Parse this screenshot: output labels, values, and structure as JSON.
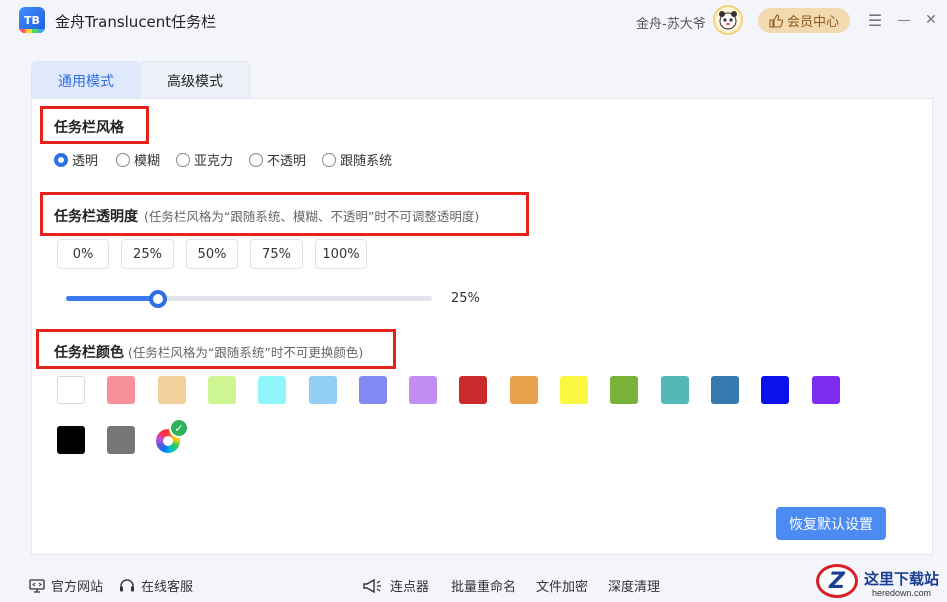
{
  "app": {
    "logo_text": "TB",
    "title": "金舟Translucent任务栏",
    "user_name": "金舟-苏大爷",
    "vip_label": "会员中心"
  },
  "window_controls": {
    "menu": "☰",
    "minimize": "—",
    "close": "✕"
  },
  "tabs": [
    {
      "label": "通用模式",
      "active": true
    },
    {
      "label": "高级模式",
      "active": false
    }
  ],
  "style_section": {
    "title": "任务栏风格",
    "options": [
      {
        "label": "透明",
        "checked": true
      },
      {
        "label": "模糊",
        "checked": false
      },
      {
        "label": "亚克力",
        "checked": false
      },
      {
        "label": "不透明",
        "checked": false
      },
      {
        "label": "跟随系统",
        "checked": false
      }
    ]
  },
  "opacity_section": {
    "title": "任务栏透明度",
    "note": "(任务栏风格为“跟随系统、模糊、不透明”时不可调整透明度)",
    "presets": [
      "0%",
      "25%",
      "50%",
      "75%",
      "100%"
    ],
    "slider_value": 25,
    "slider_label": "25%"
  },
  "color_section": {
    "title": "任务栏颜色",
    "note": "(任务栏风格为“跟随系统”时不可更换颜色)",
    "row1": [
      "#ffffff",
      "#f7909a",
      "#f2cf9b",
      "#cdf592",
      "#8ff6fb",
      "#93cff5",
      "#8389f3",
      "#c28ef4",
      "#cb2a2a",
      "#e8a24b",
      "#fbf842",
      "#7ab33a",
      "#52b8b8",
      "#3479af",
      "#0a12ea",
      "#7d2cf2"
    ],
    "row2": [
      "#000000",
      "#777777"
    ],
    "custom_selected": true
  },
  "reset_label": "恢复默认设置",
  "footer": {
    "website": "官方网站",
    "service": "在线客服",
    "clicker": "连点器",
    "rename": "批量重命名",
    "encrypt": "文件加密",
    "clean": "深度清理"
  },
  "watermark": {
    "logo_letter": "Z",
    "title": "这里下载站",
    "sub": "heredown.com"
  },
  "colors": {
    "accent": "#2e6fe8",
    "highlight_box": "#e5231b",
    "vip_bg": "#f3d9b0"
  }
}
